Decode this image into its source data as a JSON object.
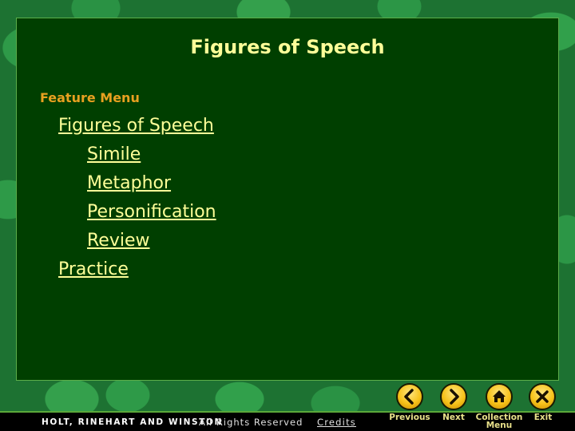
{
  "slide": {
    "title": "Figures of Speech",
    "feature_label": "Feature Menu",
    "menu_items": [
      {
        "label": "Figures of Speech",
        "level": 0
      },
      {
        "label": "Simile",
        "level": 1
      },
      {
        "label": "Metaphor",
        "level": 1
      },
      {
        "label": "Personification",
        "level": 1
      },
      {
        "label": "Review",
        "level": 1
      },
      {
        "label": "Practice",
        "level": 0
      }
    ]
  },
  "footer": {
    "publisher": "HOLT, RINEHART AND WINSTON",
    "rights": "All Rights Reserved",
    "credits": "Credits"
  },
  "nav": {
    "previous": {
      "label": "Previous",
      "icon": "chevron-left-icon"
    },
    "next": {
      "label": "Next",
      "icon": "chevron-right-icon"
    },
    "collection": {
      "label_line1": "Collection",
      "label_line2": "Menu",
      "icon": "home-icon"
    },
    "exit": {
      "label": "Exit",
      "icon": "close-icon"
    }
  },
  "colors": {
    "panel_bg": "#003f00",
    "title_text": "#ffff99",
    "feature_label": "#e8a020",
    "nav_button": "#f7c21a"
  }
}
